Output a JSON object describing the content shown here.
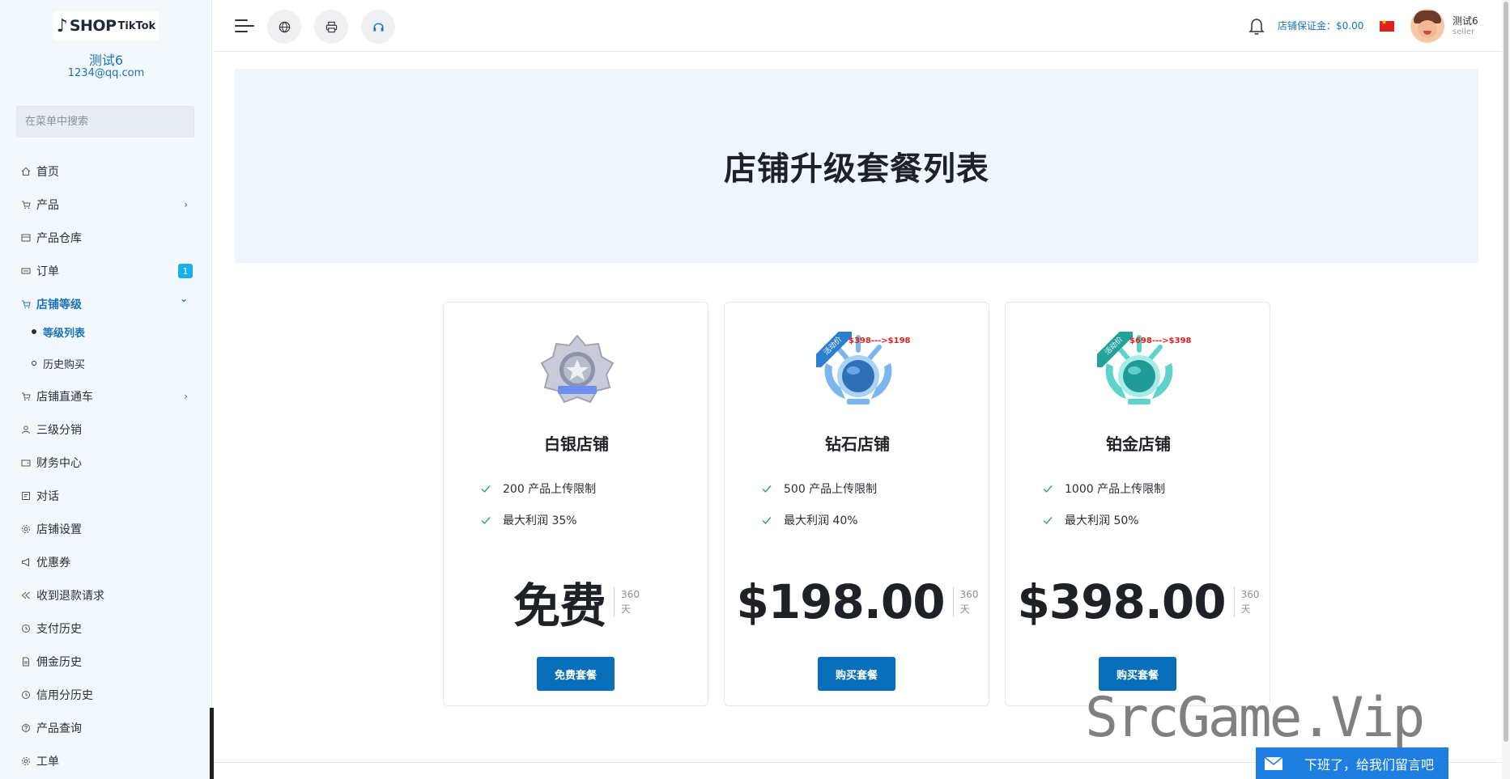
{
  "sidebar": {
    "logo": {
      "shop": "SHOP",
      "tiktok": "TikTok"
    },
    "user_name": "测试6",
    "user_email": "1234@qq.com",
    "search_placeholder": "在菜单中搜索",
    "items": [
      {
        "label": "首页",
        "icon": "home-icon"
      },
      {
        "label": "产品",
        "icon": "cart-icon",
        "chevron": "›"
      },
      {
        "label": "产品仓库",
        "icon": "warehouse-icon"
      },
      {
        "label": "订单",
        "icon": "order-icon",
        "badge": "1"
      },
      {
        "label": "店铺等级",
        "icon": "cart-icon",
        "chevron": "⌄"
      },
      {
        "label": "店铺直通车",
        "icon": "cart-icon",
        "chevron": "›"
      },
      {
        "label": "三级分销",
        "icon": "user-icon"
      },
      {
        "label": "财务中心",
        "icon": "wallet-icon"
      },
      {
        "label": "对话",
        "icon": "chat-icon"
      },
      {
        "label": "店铺设置",
        "icon": "gear-icon"
      },
      {
        "label": "优惠券",
        "icon": "megaphone-icon"
      },
      {
        "label": "收到退款请求",
        "icon": "refund-icon"
      },
      {
        "label": "支付历史",
        "icon": "history-icon"
      },
      {
        "label": "佣金历史",
        "icon": "document-icon"
      },
      {
        "label": "信用分历史",
        "icon": "history-icon"
      },
      {
        "label": "产品查询",
        "icon": "question-icon"
      },
      {
        "label": "工单",
        "icon": "gear-icon"
      }
    ],
    "sub_items": [
      {
        "label": "等级列表"
      },
      {
        "label": "历史购买"
      }
    ]
  },
  "topbar": {
    "deposit": "店铺保证金：$0.00",
    "seller_name": "测试6",
    "seller_role": "seller"
  },
  "hero": {
    "title": "店铺升级套餐列表"
  },
  "plans": [
    {
      "name": "白银店铺",
      "features": [
        "200 产品上传限制",
        "最大利润 35%"
      ],
      "price": "免费",
      "period_num": "360",
      "period_unit": "天",
      "button": "免费套餐"
    },
    {
      "name": "钻石店铺",
      "features": [
        "500 产品上传限制",
        "最大利润 40%"
      ],
      "price": "$198.00",
      "period_num": "360",
      "period_unit": "天",
      "button": "购买套餐",
      "ribbon": "活动价",
      "promo": "$398--->$198"
    },
    {
      "name": "铂金店铺",
      "features": [
        "1000 产品上传限制",
        "最大利润 50%"
      ],
      "price": "$398.00",
      "period_num": "360",
      "period_unit": "天",
      "button": "购买套餐",
      "ribbon": "活动价",
      "promo": "$698--->$398"
    }
  ],
  "watermark": "SrcGame.Vip",
  "message_bar": "下班了，给我们留言吧",
  "colors": {
    "accent": "#1a73b8",
    "button": "#0a6fbb",
    "badge": "#17b0e8",
    "check": "#2fa36b",
    "promo": "#e02020"
  }
}
